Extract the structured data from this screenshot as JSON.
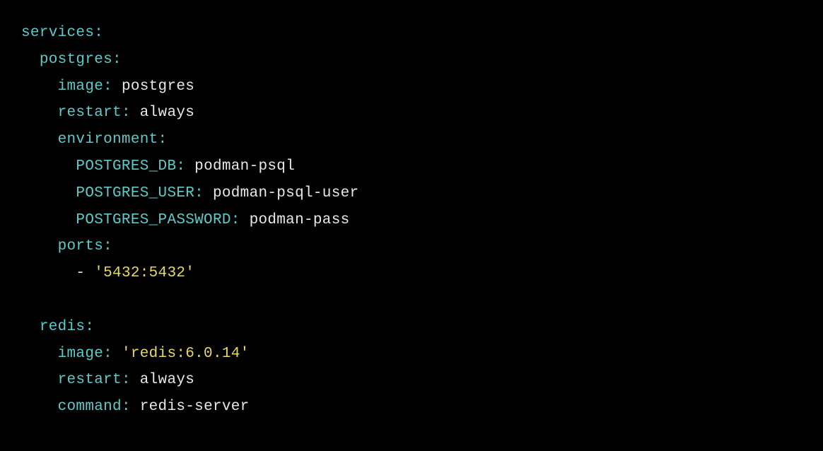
{
  "yaml": {
    "root_key": "services",
    "services": {
      "postgres": {
        "name": "postgres",
        "image_key": "image",
        "image_value": "postgres",
        "restart_key": "restart",
        "restart_value": "always",
        "environment_key": "environment",
        "env": {
          "db_key": "POSTGRES_DB",
          "db_value": "podman-psql",
          "user_key": "POSTGRES_USER",
          "user_value": "podman-psql-user",
          "password_key": "POSTGRES_PASSWORD",
          "password_value": "podman-pass"
        },
        "ports_key": "ports",
        "ports_dash": "-",
        "ports_value": "'5432:5432'"
      },
      "redis": {
        "name": "redis",
        "image_key": "image",
        "image_value": "'redis:6.0.14'",
        "restart_key": "restart",
        "restart_value": "always",
        "command_key": "command",
        "command_value": "redis-server"
      }
    },
    "colon": ":"
  }
}
